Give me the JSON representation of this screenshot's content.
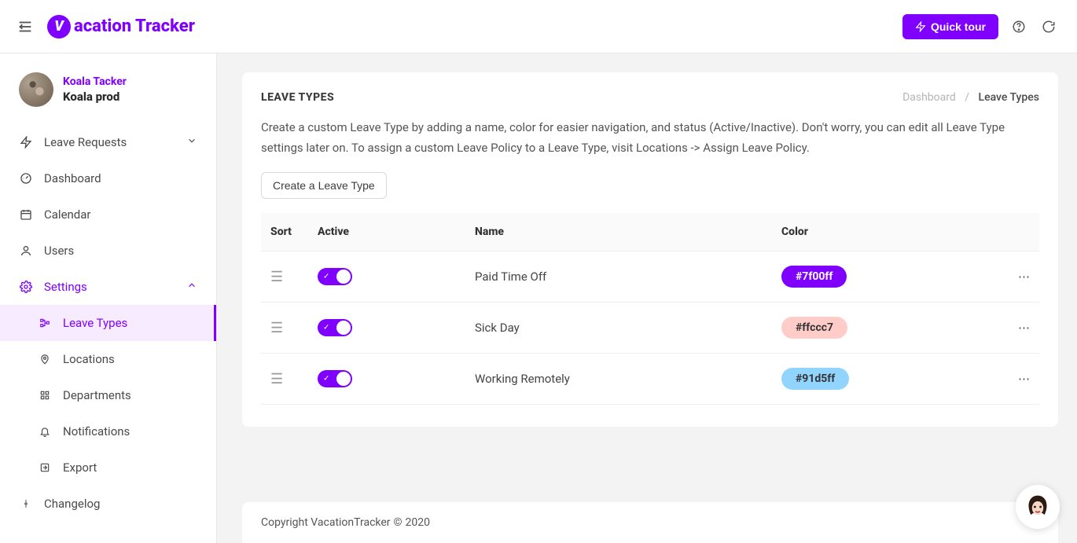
{
  "brand": {
    "name": "acation Tracker",
    "logo_letter": "V"
  },
  "header": {
    "quick_tour": "Quick tour"
  },
  "user": {
    "name": "Koala Tacker",
    "org": "Koala prod"
  },
  "sidebar": {
    "items": [
      {
        "label": "Leave Requests"
      },
      {
        "label": "Dashboard"
      },
      {
        "label": "Calendar"
      },
      {
        "label": "Users"
      },
      {
        "label": "Settings"
      }
    ],
    "settings_children": [
      {
        "label": "Leave Types"
      },
      {
        "label": "Locations"
      },
      {
        "label": "Departments"
      },
      {
        "label": "Notifications"
      },
      {
        "label": "Export"
      }
    ],
    "changelog": "Changelog"
  },
  "page": {
    "title": "LEAVE TYPES",
    "breadcrumb_dashboard": "Dashboard",
    "breadcrumb_sep": "/",
    "breadcrumb_current": "Leave Types",
    "description": "Create a custom Leave Type by adding a name, color for easier navigation, and status (Active/Inactive). Don't worry, you can edit all Leave Type settings later on. To assign a custom Leave Policy to a Leave Type, visit Locations -> Assign Leave Policy.",
    "create_button": "Create a Leave Type",
    "columns": {
      "sort": "Sort",
      "active": "Active",
      "name": "Name",
      "color": "Color"
    },
    "rows": [
      {
        "name": "Paid Time Off",
        "color": "#7f00ff",
        "text_color": "#ffffff",
        "active": true
      },
      {
        "name": "Sick Day",
        "color": "#ffccc7",
        "text_color": "#333333",
        "active": true
      },
      {
        "name": "Working Remotely",
        "color": "#91d5ff",
        "text_color": "#333333",
        "active": true
      }
    ]
  },
  "footer": {
    "copyright_prefix": "Copyright VacationTracker",
    "year": "2020"
  }
}
